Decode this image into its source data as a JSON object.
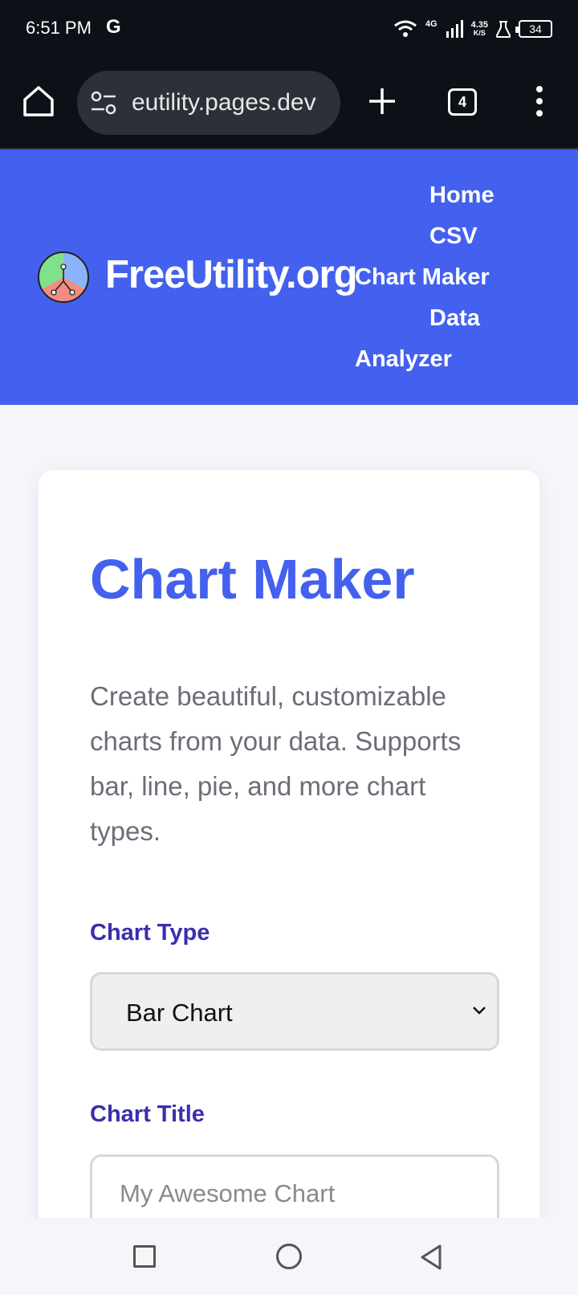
{
  "status_bar": {
    "time": "6:51 PM",
    "google_badge": "G",
    "network_type": "4G",
    "speed_value": "4.35",
    "speed_unit": "K/S",
    "battery": "34"
  },
  "browser": {
    "url": "eutility.pages.dev",
    "tab_count": "4"
  },
  "site": {
    "name": "FreeUtility.org",
    "nav": [
      {
        "label": "Home"
      },
      {
        "label": "CSV"
      },
      {
        "label": "Chart Maker"
      },
      {
        "label": "Data"
      },
      {
        "label": "Analyzer"
      }
    ]
  },
  "page": {
    "title": "Chart Maker",
    "description": "Create beautiful, customizable charts from your data. Supports bar, line, pie, and more chart types.",
    "chart_type_label": "Chart Type",
    "chart_type_value": "Bar Chart",
    "chart_title_label": "Chart Title",
    "chart_title_placeholder": "My Awesome Chart"
  },
  "colors": {
    "brand": "#4361ee",
    "label": "#3a2eae",
    "status_bg": "#0d1117"
  }
}
